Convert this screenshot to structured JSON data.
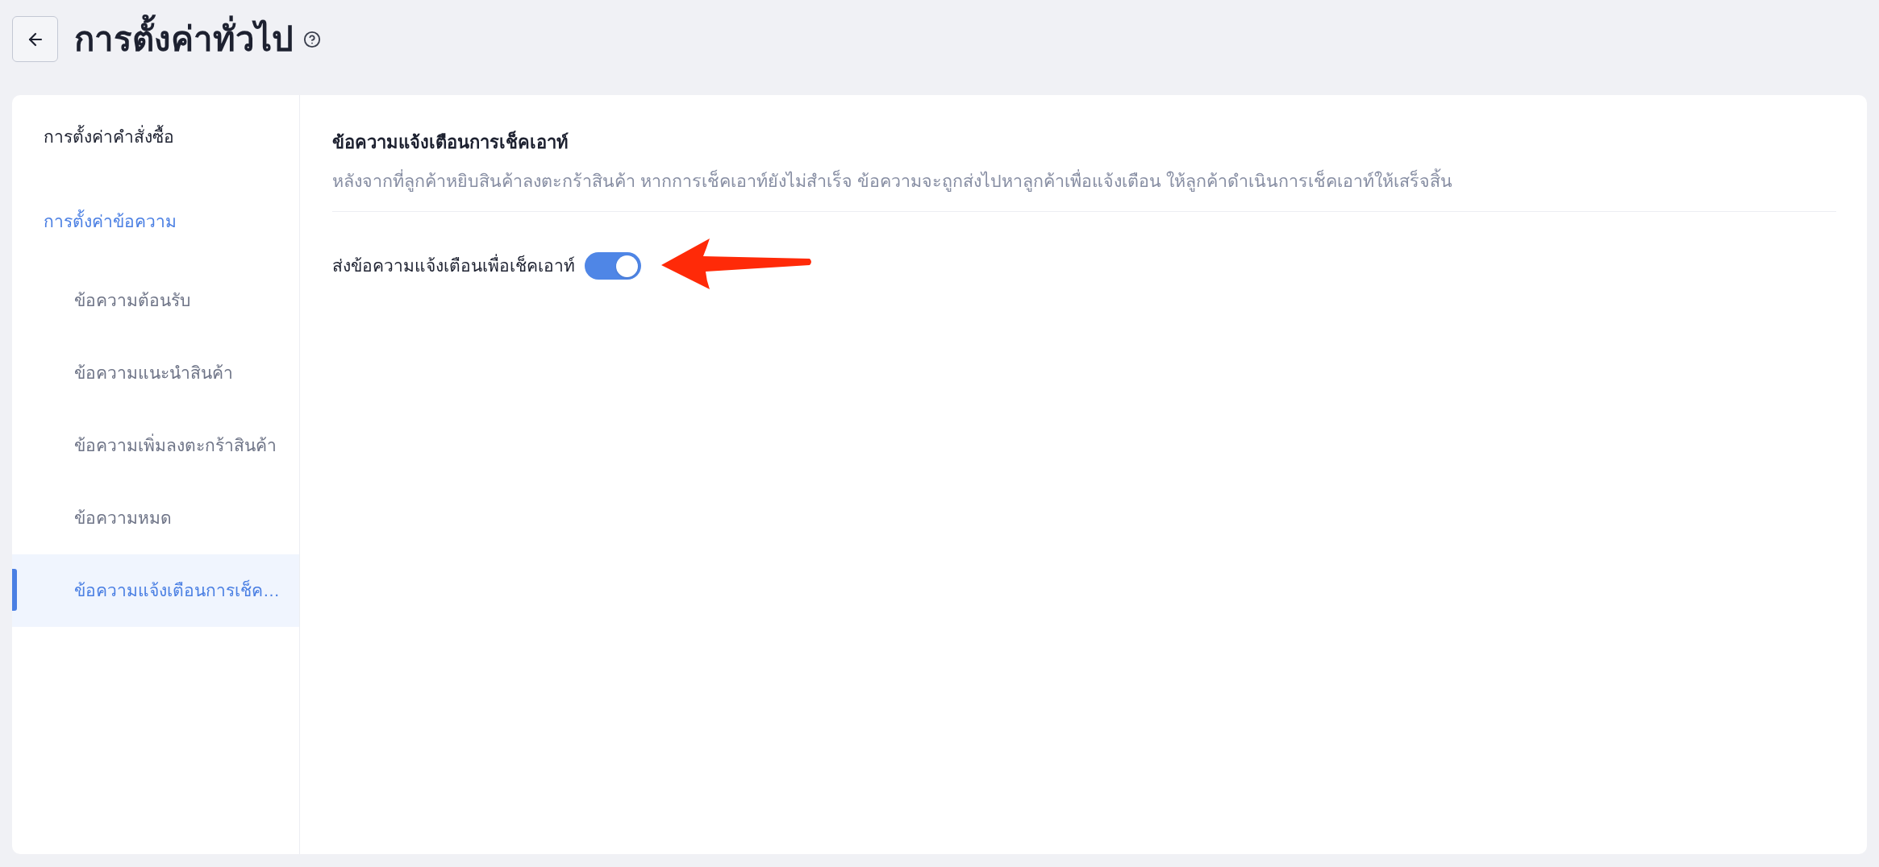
{
  "header": {
    "title": "การตั้งค่าทั่วไป"
  },
  "sidebar": {
    "items": [
      {
        "label": "การตั้งค่าคำสั่งซื้อ",
        "selected": false
      },
      {
        "label": "การตั้งค่าข้อความ",
        "selected": true,
        "children": [
          {
            "label": "ข้อความต้อนรับ",
            "selected": false
          },
          {
            "label": "ข้อความแนะนำสินค้า",
            "selected": false
          },
          {
            "label": "ข้อความเพิ่มลงตะกร้าสินค้า",
            "selected": false
          },
          {
            "label": "ข้อความหมด",
            "selected": false
          },
          {
            "label": "ข้อความแจ้งเตือนการเช็ค…",
            "selected": true
          }
        ]
      }
    ]
  },
  "section": {
    "title": "ข้อความแจ้งเตือนการเช็คเอาท์",
    "description": "หลังจากที่ลูกค้าหยิบสินค้าลงตะกร้าสินค้า หากการเช็คเอาท์ยังไม่สำเร็จ ข้อความจะถูกส่งไปหาลูกค้าเพื่อแจ้งเตือน ให้ลูกค้าดำเนินการเช็คเอาท์ให้เสร็จสิ้น",
    "settings": [
      {
        "label": "ส่งข้อความแจ้งเตือนเพื่อเช็คเอาท์",
        "on": true
      }
    ]
  }
}
